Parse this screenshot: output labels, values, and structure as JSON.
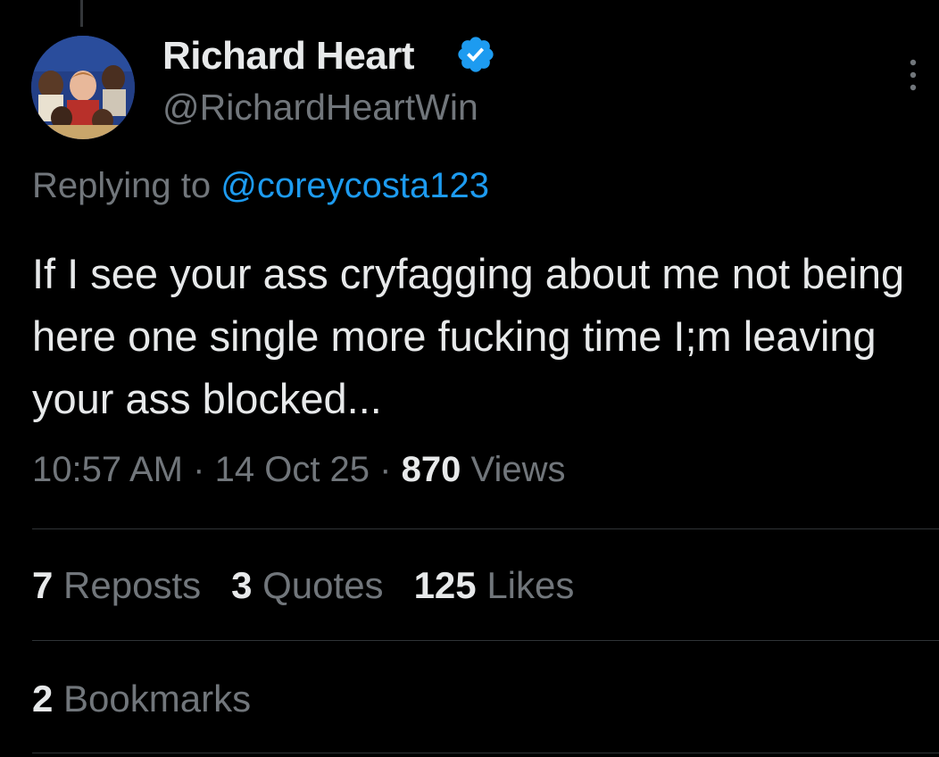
{
  "author": {
    "display_name": "Richard Heart",
    "handle": "@RichardHeartWin",
    "verified_icon": "verified-badge-icon",
    "verified_color": "#1d9bf0"
  },
  "reply": {
    "prefix": "Replying to",
    "mention": "@coreycosta123"
  },
  "tweet": {
    "text": "If I see your ass cryfagging about me not being here one single more fucking time I;m leaving your ass blocked..."
  },
  "meta": {
    "time": "10:57 AM",
    "date": "14 Oct 25",
    "separator": "·",
    "views_count": "870",
    "views_label": "Views"
  },
  "stats": {
    "reposts_count": "7",
    "reposts_label": "Reposts",
    "quotes_count": "3",
    "quotes_label": "Quotes",
    "likes_count": "125",
    "likes_label": "Likes",
    "bookmarks_count": "2",
    "bookmarks_label": "Bookmarks"
  },
  "colors": {
    "background": "#000000",
    "text_primary": "#e7e9ea",
    "text_secondary": "#71767b",
    "link": "#1d9bf0",
    "divider": "#2f3336"
  }
}
